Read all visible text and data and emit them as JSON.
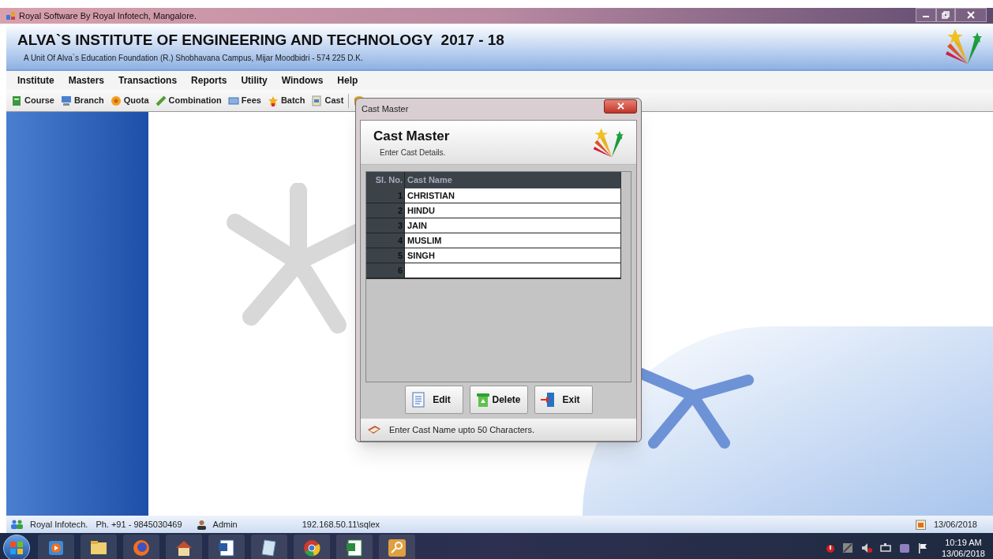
{
  "window": {
    "title": "Royal Software By Royal Infotech, Mangalore."
  },
  "header": {
    "title": "ALVA`S INSTITUTE OF ENGINEERING AND TECHNOLOGY  2017 - 18",
    "subtitle": "A Unit Of Alva`s Education Foundation (R.) Shobhavana Campus, Mijar Moodbidri - 574 225 D.K."
  },
  "menu": [
    "Institute",
    "Masters",
    "Transactions",
    "Reports",
    "Utility",
    "Windows",
    "Help"
  ],
  "toolbar": [
    {
      "kind": "course",
      "label": "Course"
    },
    {
      "kind": "branch",
      "label": "Branch"
    },
    {
      "kind": "quota",
      "label": "Quota"
    },
    {
      "kind": "combination",
      "label": "Combination"
    },
    {
      "kind": "fees",
      "label": "Fees"
    },
    {
      "kind": "batch",
      "label": "Batch"
    },
    {
      "kind": "cast",
      "label": "Cast"
    }
  ],
  "dialog": {
    "title": "Cast Master",
    "heading": "Cast Master",
    "subheading": "Enter Cast Details.",
    "columns": [
      "Sl. No.",
      "Cast Name"
    ],
    "rows": [
      {
        "sl": "1",
        "name": "CHRISTIAN"
      },
      {
        "sl": "2",
        "name": "HINDU"
      },
      {
        "sl": "3",
        "name": "JAIN"
      },
      {
        "sl": "4",
        "name": "MUSLIM"
      },
      {
        "sl": "5",
        "name": "SINGH"
      },
      {
        "sl": "6"
      }
    ],
    "buttons": [
      {
        "kind": "edit",
        "label": "Edit"
      },
      {
        "kind": "delete",
        "label": "Delete"
      },
      {
        "kind": "exit",
        "label": "Exit"
      }
    ],
    "status": "Enter Cast Name upto 50 Characters."
  },
  "status_bar": {
    "company": "Royal Infotech.",
    "phone": "Ph. +91 - 9845030469",
    "user": "Admin",
    "server": "192.168.50.11\\sqlex",
    "date": "13/06/2018"
  },
  "taskbar": {
    "time": "10:19 AM",
    "date": "13/06/2018"
  }
}
